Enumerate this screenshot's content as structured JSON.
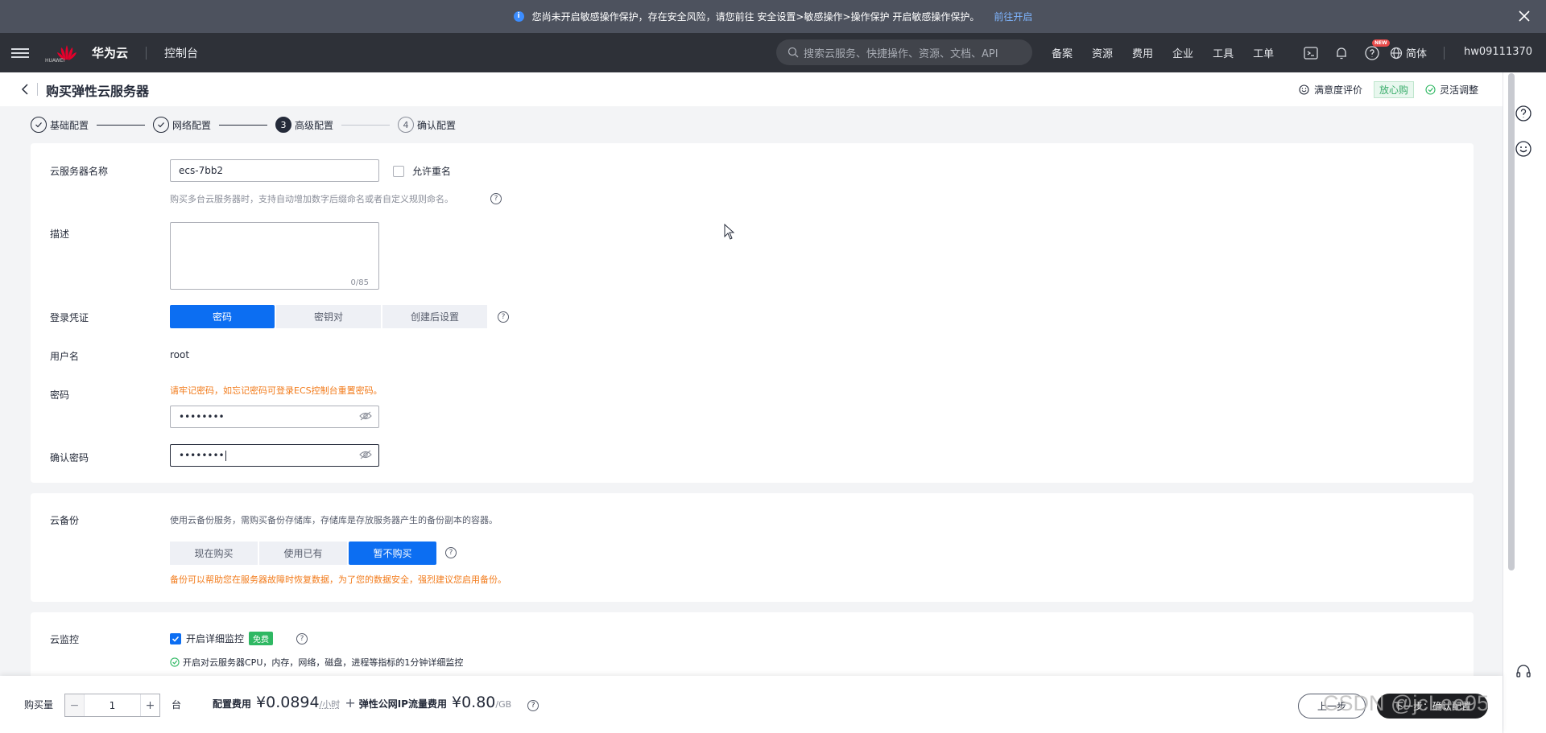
{
  "notice": {
    "text": "您尚未开启敏感操作保护，存在安全风险，请您前往 安全设置>敏感操作>操作保护 开启敏感操作保护。",
    "link": "前往开启"
  },
  "topnav": {
    "brand_small": "HUAWEI",
    "brand": "华为云",
    "console": "控制台",
    "search_placeholder": "搜索云服务、快捷操作、资源、文档、API",
    "links": [
      "备案",
      "资源",
      "费用",
      "企业",
      "工具",
      "工单"
    ],
    "new_badge": "NEW",
    "lang": "简体",
    "user": "hw09111370"
  },
  "header": {
    "title": "购买弹性云服务器",
    "satisfaction": "满意度评价",
    "tag": "放心购",
    "flex_adjust": "灵活调整"
  },
  "steps": [
    {
      "label": "基础配置",
      "state": "done"
    },
    {
      "label": "网络配置",
      "state": "done"
    },
    {
      "label": "高级配置",
      "state": "active",
      "num": "3"
    },
    {
      "label": "确认配置",
      "state": "todo",
      "num": "4"
    }
  ],
  "form": {
    "name_label": "云服务器名称",
    "name_value": "ecs-7bb2",
    "allow_dup": "允许重名",
    "name_hint": "购买多台云服务器时，支持自动增加数字后缀命名或者自定义规则命名。",
    "desc_label": "描述",
    "desc_counter": "0/85",
    "cred_label": "登录凭证",
    "cred_options": [
      "密码",
      "密钥对",
      "创建后设置"
    ],
    "username_label": "用户名",
    "username_value": "root",
    "password_label": "密码",
    "password_warn": "请牢记密码，如忘记密码可登录ECS控制台重置密码。",
    "password_value": "••••••••",
    "confirm_label": "确认密码",
    "confirm_value": "••••••••"
  },
  "backup": {
    "label": "云备份",
    "desc": "使用云备份服务，需购买备份存储库，存储库是存放服务器产生的备份副本的容器。",
    "options": [
      "现在购买",
      "使用已有",
      "暂不购买"
    ],
    "warn": "备份可以帮助您在服务器故障时恢复数据，为了您的数据安全，强烈建议您启用备份。"
  },
  "monitor": {
    "label": "云监控",
    "check_label": "开启详细监控",
    "free": "免费",
    "desc": "开启对云服务器CPU，内存，网络，磁盘，进程等指标的1分钟详细监控"
  },
  "bottom": {
    "qty_label": "购买量",
    "qty_value": "1",
    "minus": "−",
    "plus": "+",
    "unit": "台",
    "fee_label": "配置费用",
    "fee_price": "¥0.0894",
    "fee_per": "/小时",
    "plus_sign": "+",
    "ip_label": "弹性公网IP流量费用",
    "ip_price": "¥0.80",
    "ip_per": "/GB",
    "prev": "上一步",
    "next": "下一步：确认配置",
    "watermark": "CSDN @jcLee95"
  },
  "colors": {
    "primary": "#0c6ef2",
    "warning": "#f27b1b",
    "dark_nav": "#2e3138",
    "notice_bg": "#4d525e",
    "success": "#2fb863"
  }
}
